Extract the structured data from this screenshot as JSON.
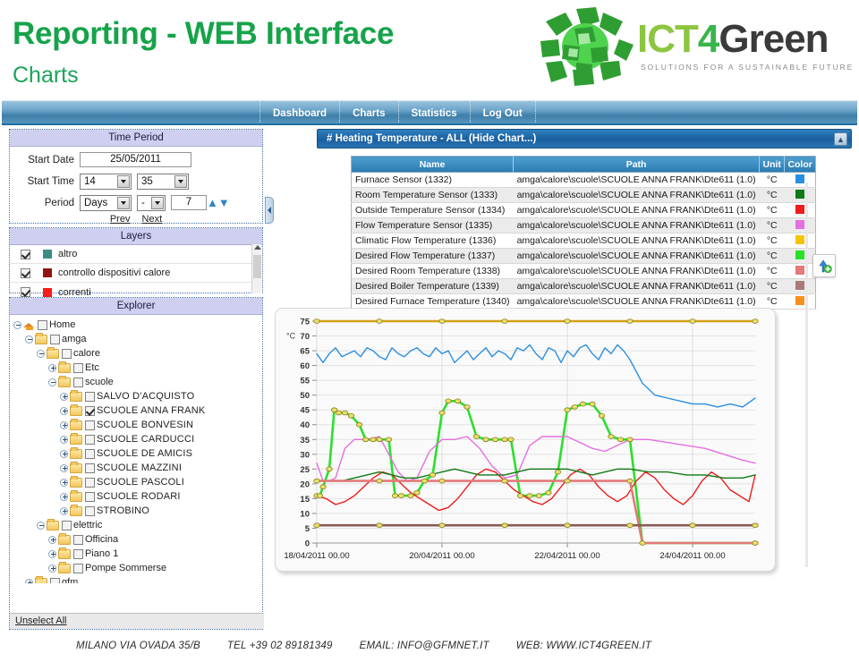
{
  "header": {
    "title": "Reporting - WEB Interface",
    "subtitle": "Charts",
    "logo": {
      "text_ict": "ICT",
      "text_4": "4",
      "text_green": "Green",
      "tagline": "SOLUTIONS FOR A SUSTAINABLE FUTURE"
    }
  },
  "nav": {
    "items": [
      {
        "label": "Dashboard"
      },
      {
        "label": "Charts"
      },
      {
        "label": "Statistics"
      },
      {
        "label": "Log Out"
      }
    ]
  },
  "time_period": {
    "title": "Time Period",
    "start_date_label": "Start Date",
    "start_date_value": "25/05/2011",
    "start_time_label": "Start Time",
    "start_time_hour": "14",
    "start_time_minute": "35",
    "period_label": "Period",
    "period_unit": "Days",
    "period_sign": "-",
    "period_count": "7",
    "prev_label": "Prev",
    "next_label": "Next"
  },
  "layers": {
    "title": "Layers",
    "items": [
      {
        "label": "altro",
        "color": "#3c8c85",
        "checked": true
      },
      {
        "label": "controllo dispositivi calore",
        "color": "#8f1414",
        "checked": true
      },
      {
        "label": "correnti",
        "color": "#f41c1c",
        "checked": true
      }
    ]
  },
  "explorer": {
    "title": "Explorer",
    "unselect_all": "Unselect All",
    "nodes": [
      {
        "label": "Home",
        "indent": 0,
        "icon": "home-icon",
        "toggle": "minus",
        "checked": false
      },
      {
        "label": "amga",
        "indent": 1,
        "icon": "folder-icon",
        "toggle": "minus",
        "checked": false
      },
      {
        "label": "calore",
        "indent": 2,
        "icon": "folder-icon",
        "toggle": "minus",
        "checked": false
      },
      {
        "label": "Etc",
        "indent": 3,
        "icon": "folder-icon",
        "toggle": "plus",
        "checked": false
      },
      {
        "label": "scuole",
        "indent": 3,
        "icon": "folder-icon",
        "toggle": "minus",
        "checked": false
      },
      {
        "label": "SALVO D'ACQUISTO",
        "indent": 4,
        "icon": "folder-icon",
        "toggle": "plus",
        "checked": false
      },
      {
        "label": "SCUOLE ANNA FRANK",
        "indent": 4,
        "icon": "folder-icon",
        "toggle": "plus",
        "checked": true
      },
      {
        "label": "SCUOLE BONVESIN",
        "indent": 4,
        "icon": "folder-icon",
        "toggle": "plus",
        "checked": false
      },
      {
        "label": "SCUOLE CARDUCCI",
        "indent": 4,
        "icon": "folder-icon",
        "toggle": "plus",
        "checked": false
      },
      {
        "label": "SCUOLE DE AMICIS",
        "indent": 4,
        "icon": "folder-icon",
        "toggle": "plus",
        "checked": false
      },
      {
        "label": "SCUOLE MAZZINI",
        "indent": 4,
        "icon": "folder-icon",
        "toggle": "plus",
        "checked": false
      },
      {
        "label": "SCUOLE PASCOLI",
        "indent": 4,
        "icon": "folder-icon",
        "toggle": "plus",
        "checked": false
      },
      {
        "label": "SCUOLE RODARI",
        "indent": 4,
        "icon": "folder-icon",
        "toggle": "plus",
        "checked": false
      },
      {
        "label": "STROBINO",
        "indent": 4,
        "icon": "folder-icon",
        "toggle": "plus",
        "checked": false
      },
      {
        "label": "elettric",
        "indent": 2,
        "icon": "folder-icon",
        "toggle": "minus",
        "checked": false
      },
      {
        "label": "Officina",
        "indent": 3,
        "icon": "folder-icon",
        "toggle": "plus",
        "checked": false
      },
      {
        "label": "Piano 1",
        "indent": 3,
        "icon": "folder-icon",
        "toggle": "plus",
        "checked": false
      },
      {
        "label": "Pompe Sommerse",
        "indent": 3,
        "icon": "folder-icon",
        "toggle": "plus",
        "checked": false
      },
      {
        "label": "gfm",
        "indent": 1,
        "icon": "folder-icon",
        "toggle": "plus",
        "checked": false
      }
    ]
  },
  "chart_panel": {
    "title": "# Heating Temperature - ALL  (Hide Chart...)",
    "collapse_icon": "collapse-icon",
    "export_icon": "export-upload-icon"
  },
  "sensor_table": {
    "columns": [
      "Name",
      "Path",
      "Unit",
      "Color"
    ],
    "rows": [
      {
        "name": "Furnace Sensor (1332)",
        "path": "amga\\calore\\scuole\\SCUOLE ANNA FRANK\\Dte611 (1.0)",
        "unit": "°C",
        "color": "#2b8fe0"
      },
      {
        "name": "Room Temperature Sensor (1333)",
        "path": "amga\\calore\\scuole\\SCUOLE ANNA FRANK\\Dte611 (1.0)",
        "unit": "°C",
        "color": "#0f7a18"
      },
      {
        "name": "Outside Temperature Sensor (1334)",
        "path": "amga\\calore\\scuole\\SCUOLE ANNA FRANK\\Dte611 (1.0)",
        "unit": "°C",
        "color": "#ee1c1c"
      },
      {
        "name": "Flow Temperature Sensor (1335)",
        "path": "amga\\calore\\scuole\\SCUOLE ANNA FRANK\\Dte611 (1.0)",
        "unit": "°C",
        "color": "#e46fe0"
      },
      {
        "name": "Climatic Flow Temperature (1336)",
        "path": "amga\\calore\\scuole\\SCUOLE ANNA FRANK\\Dte611 (1.0)",
        "unit": "°C",
        "color": "#f4c400"
      },
      {
        "name": "Desired Flow Temperature (1337)",
        "path": "amga\\calore\\scuole\\SCUOLE ANNA FRANK\\Dte611 (1.0)",
        "unit": "°C",
        "color": "#2ae02a"
      },
      {
        "name": "Desired Room Temperature (1338)",
        "path": "amga\\calore\\scuole\\SCUOLE ANNA FRANK\\Dte611 (1.0)",
        "unit": "°C",
        "color": "#e57878"
      },
      {
        "name": "Desired Boiler Temperature (1339)",
        "path": "amga\\calore\\scuole\\SCUOLE ANNA FRANK\\Dte611 (1.0)",
        "unit": "°C",
        "color": "#a87b78"
      },
      {
        "name": "Desired Furnace Temperature (1340)",
        "path": "amga\\calore\\scuole\\SCUOLE ANNA FRANK\\Dte611 (1.0)",
        "unit": "°C",
        "color": "#f5911e"
      }
    ]
  },
  "chart_data": {
    "type": "line",
    "title": "# Heating Temperature - ALL",
    "xlabel": "",
    "ylabel": "°C",
    "ylim": [
      0,
      75
    ],
    "yticks": [
      0,
      5,
      10,
      15,
      20,
      25,
      30,
      35,
      40,
      45,
      50,
      55,
      60,
      65,
      70,
      75
    ],
    "xticks": [
      "18/04/2011 00.00",
      "20/04/2011 00.00",
      "22/04/2011 00.00",
      "24/04/2011 00.00"
    ],
    "xlim": [
      "18/04/2011 00.00",
      "25/04/2011 00.00"
    ],
    "grid": true,
    "legend": "none",
    "series": [
      {
        "name": "Desired Furnace Temperature (1340)",
        "color": "#d4a017",
        "markers": true,
        "x": [
          0,
          0.12,
          1.0,
          2.0,
          3.0,
          4.0,
          5.0,
          6.0,
          7.0
        ],
        "values": [
          75,
          75,
          75,
          75,
          75,
          75,
          75,
          75,
          75
        ]
      },
      {
        "name": "Furnace Sensor (1332)",
        "color": "#2b8fe0",
        "markers": false,
        "x": [
          0,
          0.1,
          0.2,
          0.3,
          0.4,
          0.5,
          0.6,
          0.7,
          0.8,
          0.9,
          1.0,
          1.1,
          1.2,
          1.3,
          1.4,
          1.5,
          1.6,
          1.7,
          1.8,
          1.9,
          2.0,
          2.1,
          2.2,
          2.3,
          2.4,
          2.5,
          2.6,
          2.7,
          2.8,
          2.9,
          3.0,
          3.1,
          3.2,
          3.3,
          3.4,
          3.5,
          3.6,
          3.7,
          3.8,
          3.9,
          4.0,
          4.1,
          4.2,
          4.3,
          4.4,
          4.5,
          4.6,
          4.7,
          4.8,
          4.9,
          5.0,
          5.2,
          5.4,
          5.6,
          5.8,
          6.0,
          6.2,
          6.4,
          6.6,
          6.8,
          7.0
        ],
        "values": [
          64,
          61,
          64,
          66,
          63,
          64,
          65,
          63,
          66,
          65,
          63,
          62,
          66,
          64,
          63,
          65,
          66,
          64,
          63,
          66,
          64,
          65,
          61,
          63,
          65,
          62,
          64,
          66,
          63,
          65,
          64,
          62,
          66,
          65,
          67,
          64,
          62,
          66,
          65,
          61,
          65,
          63,
          66,
          67,
          64,
          62,
          66,
          64,
          67,
          65,
          62,
          54,
          50,
          49,
          48,
          47,
          47,
          46,
          47,
          46,
          49
        ]
      },
      {
        "name": "Desired Flow Temperature (1337)",
        "color": "#2ae02a",
        "markers": true,
        "x": [
          0,
          0.05,
          0.1,
          0.2,
          0.28,
          0.35,
          0.45,
          0.55,
          0.68,
          0.78,
          0.9,
          1.0,
          1.15,
          1.25,
          1.35,
          1.5,
          1.6,
          1.72,
          1.85,
          2.0,
          2.1,
          2.25,
          2.4,
          2.55,
          2.7,
          2.85,
          3.0,
          3.1,
          3.25,
          3.4,
          3.55,
          3.7,
          3.85,
          4.0,
          4.12,
          4.25,
          4.4,
          4.55,
          4.7,
          4.85,
          5.0,
          5.2,
          7.0
        ],
        "values": [
          16,
          16,
          19,
          25,
          45,
          44,
          44,
          43,
          40,
          35,
          35,
          35,
          35,
          16,
          16,
          16,
          17,
          21,
          23,
          44,
          48,
          48,
          46,
          36,
          35,
          35,
          35,
          35,
          16,
          16,
          16,
          17,
          24,
          45,
          46,
          47,
          47,
          43,
          36,
          35,
          35,
          0,
          0
        ]
      },
      {
        "name": "Flow Temperature Sensor (1335)",
        "color": "#e46fe0",
        "markers": false,
        "x": [
          0,
          0.1,
          0.2,
          0.3,
          0.45,
          0.6,
          0.8,
          1.0,
          1.15,
          1.3,
          1.45,
          1.6,
          1.8,
          2.0,
          2.2,
          2.4,
          2.6,
          2.8,
          3.0,
          3.2,
          3.4,
          3.6,
          3.8,
          4.0,
          4.2,
          4.4,
          4.6,
          4.8,
          5.0,
          5.3,
          5.6,
          5.9,
          6.2,
          6.5,
          6.8,
          7.0
        ],
        "values": [
          27,
          21,
          21,
          22,
          32,
          35,
          35,
          36,
          30,
          24,
          21,
          22,
          31,
          35,
          35,
          36,
          32,
          26,
          22,
          23,
          33,
          36,
          36,
          36,
          34,
          32,
          31,
          33,
          35,
          35,
          34,
          33,
          32,
          30,
          28,
          27
        ]
      },
      {
        "name": "Outside Temperature Sensor (1334)",
        "color": "#ee1c1c",
        "markers": false,
        "x": [
          0,
          0.15,
          0.3,
          0.45,
          0.6,
          0.75,
          0.9,
          1.05,
          1.2,
          1.35,
          1.5,
          1.65,
          1.8,
          1.95,
          2.1,
          2.25,
          2.4,
          2.55,
          2.7,
          2.85,
          3.0,
          3.15,
          3.3,
          3.45,
          3.6,
          3.75,
          3.9,
          4.05,
          4.2,
          4.35,
          4.5,
          4.65,
          4.8,
          4.95,
          5.1,
          5.25,
          5.4,
          5.55,
          5.7,
          5.85,
          6.0,
          6.15,
          6.3,
          6.45,
          6.6,
          6.75,
          6.9,
          7.0
        ],
        "values": [
          16,
          15,
          13,
          14,
          16,
          19,
          22,
          24,
          23,
          20,
          17,
          15,
          13,
          11,
          12,
          15,
          19,
          23,
          25,
          24,
          21,
          18,
          16,
          14,
          13,
          15,
          19,
          23,
          25,
          23,
          19,
          16,
          14,
          16,
          21,
          24,
          22,
          18,
          15,
          13,
          16,
          21,
          24,
          22,
          18,
          16,
          14,
          23
        ]
      },
      {
        "name": "Room Temperature Sensor (1333)",
        "color": "#0f7a18",
        "markers": false,
        "x": [
          0,
          0.2,
          0.4,
          0.6,
          0.8,
          1.0,
          1.2,
          1.4,
          1.6,
          1.8,
          2.0,
          2.2,
          2.4,
          2.6,
          2.8,
          3.0,
          3.2,
          3.4,
          3.6,
          3.8,
          4.0,
          4.2,
          4.4,
          4.6,
          4.8,
          5.0,
          5.3,
          5.6,
          5.9,
          6.2,
          6.5,
          6.8,
          7.0
        ],
        "values": [
          21,
          21,
          21,
          22,
          23,
          24,
          23,
          22,
          22,
          23,
          24,
          25,
          24,
          23,
          23,
          23,
          24,
          25,
          25,
          25,
          25,
          24,
          23,
          24,
          25,
          25,
          24,
          24,
          23,
          23,
          22,
          22,
          23
        ]
      },
      {
        "name": "Desired Room Temperature (1338)",
        "color": "#e57878",
        "markers": true,
        "x": [
          0,
          1.0,
          2.0,
          3.0,
          4.0,
          5.0,
          5.2,
          7.0
        ],
        "values": [
          21,
          21,
          21,
          21,
          21,
          21,
          0,
          0
        ]
      },
      {
        "name": "Desired Boiler Temperature (1339)",
        "color": "#8a5a57",
        "markers": true,
        "x": [
          0,
          1.0,
          2.0,
          3.0,
          4.0,
          5.0,
          6.0,
          7.0
        ],
        "values": [
          6,
          6,
          6,
          6,
          6,
          6,
          6,
          6
        ]
      }
    ]
  },
  "footer": {
    "address": "MILANO  VIA OVADA 35/B",
    "tel": "TEL +39 02 89181349",
    "email": "EMAIL: INFO@GFMNET.IT",
    "web": "WEB: WWW.ICT4GREEN.IT"
  }
}
